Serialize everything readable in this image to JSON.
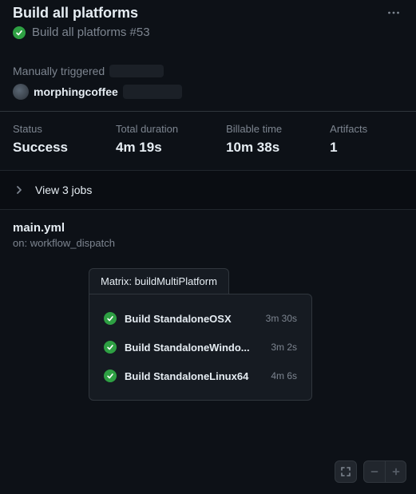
{
  "header": {
    "title": "Build all platforms",
    "run_label": "Build all platforms #53"
  },
  "trigger": {
    "mode": "Manually triggered",
    "actor": "morphingcoffee"
  },
  "summary": {
    "status_label": "Status",
    "status_value": "Success",
    "duration_label": "Total duration",
    "duration_value": "4m 19s",
    "billable_label": "Billable time",
    "billable_value": "10m 38s",
    "artifacts_label": "Artifacts",
    "artifacts_value": "1"
  },
  "jobs_toggle": {
    "label": "View 3 jobs"
  },
  "workflow": {
    "file": "main.yml",
    "on_prefix": "on:",
    "on_value": "workflow_dispatch"
  },
  "matrix": {
    "tab_label": "Matrix: buildMultiPlatform",
    "jobs": [
      {
        "name": "Build StandaloneOSX",
        "time": "3m 30s"
      },
      {
        "name": "Build StandaloneWindo...",
        "time": "3m 2s"
      },
      {
        "name": "Build StandaloneLinux64",
        "time": "4m 6s"
      }
    ]
  },
  "colors": {
    "success": "#2ea043"
  }
}
